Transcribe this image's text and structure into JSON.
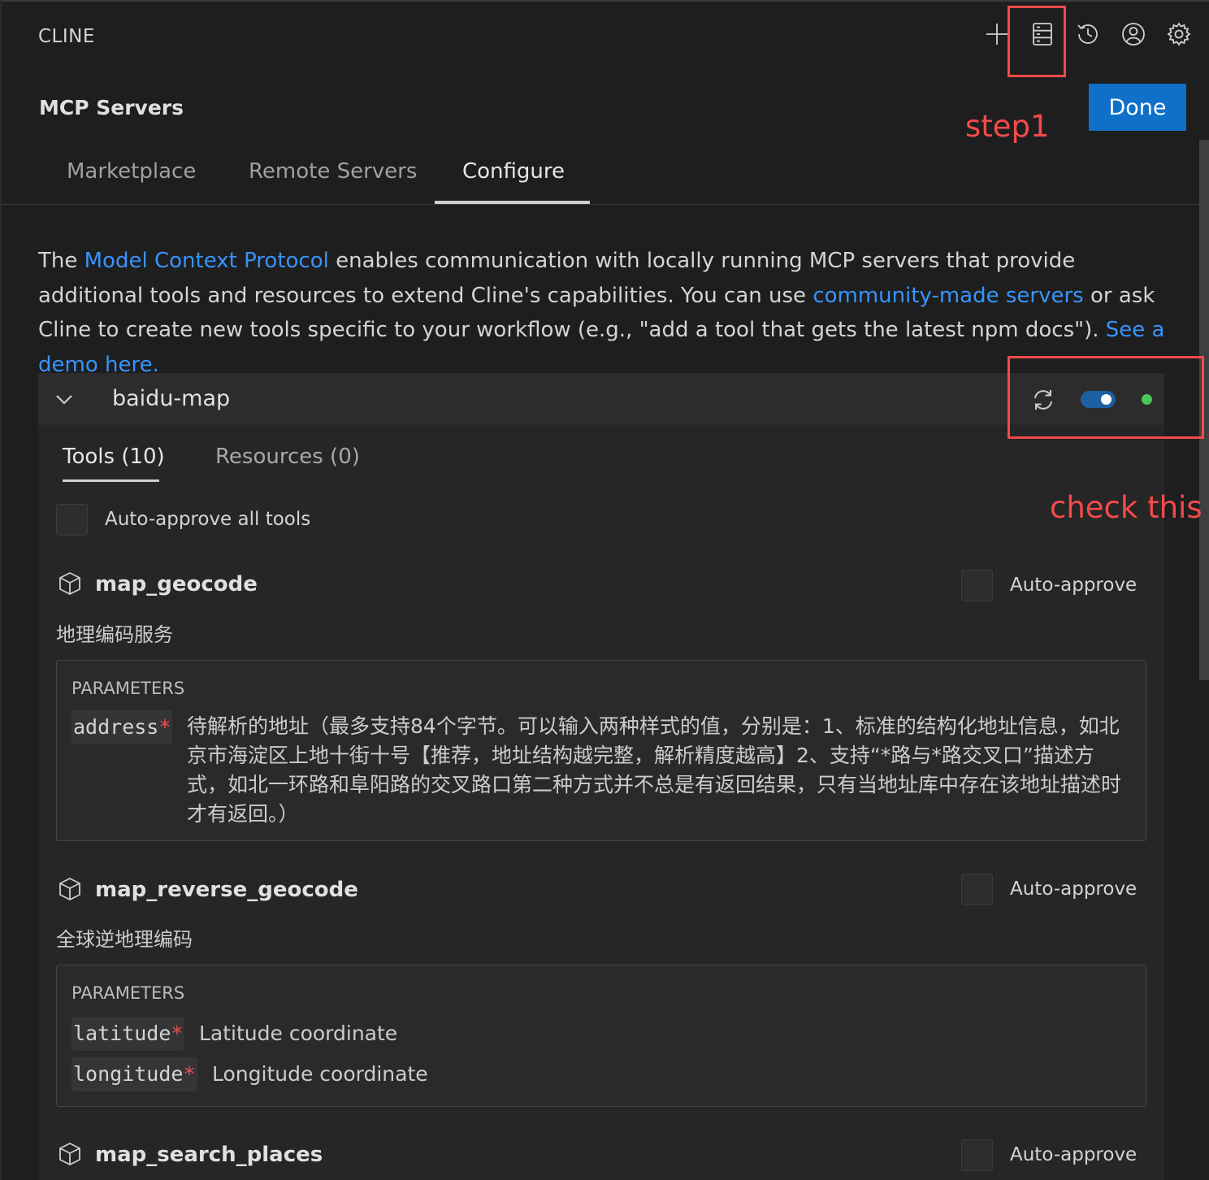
{
  "app": {
    "title": "CLINE"
  },
  "toolbar": {
    "items": [
      {
        "icon": "plus-icon"
      },
      {
        "icon": "server-stack-icon"
      },
      {
        "icon": "history-icon"
      },
      {
        "icon": "account-icon"
      },
      {
        "icon": "gear-icon"
      }
    ]
  },
  "page": {
    "title": "MCP Servers",
    "done_label": "Done"
  },
  "tabs": [
    {
      "label": "Marketplace",
      "active": false
    },
    {
      "label": "Remote Servers",
      "active": false
    },
    {
      "label": "Configure",
      "active": true
    }
  ],
  "intro": {
    "t1": "The ",
    "link1": "Model Context Protocol",
    "t2": " enables communication with locally running MCP servers that provide additional tools and resources to extend Cline's capabilities. You can use ",
    "link2": "community-made servers",
    "t3": " or ask Cline to create new tools specific to your workflow (e.g., \"add a tool that gets the latest npm docs\"). ",
    "link3": "See a demo here."
  },
  "server": {
    "name": "baidu-map",
    "enabled": true,
    "status_color": "#4cc659",
    "subtabs": [
      {
        "label": "Tools (10)",
        "active": true
      },
      {
        "label": "Resources (0)",
        "active": false
      }
    ],
    "auto_approve_all_label": "Auto-approve all tools",
    "auto_approve_label": "Auto-approve",
    "parameters_label": "PARAMETERS",
    "tools": [
      {
        "name": "map_geocode",
        "description": "地理编码服务",
        "params": [
          {
            "name": "address",
            "required": "*",
            "description": "待解析的地址（最多支持84个字节。可以输入两种样式的值，分别是：1、标准的结构化地址信息，如北京市海淀区上地十街十号【推荐，地址结构越完整，解析精度越高】2、支持“*路与*路交叉口”描述方式，如北一环路和阜阳路的交叉路口第二种方式并不总是有返回结果，只有当地址库中存在该地址描述时才有返回。）"
          }
        ]
      },
      {
        "name": "map_reverse_geocode",
        "description": "全球逆地理编码",
        "params": [
          {
            "name": "latitude",
            "required": "*",
            "description": "Latitude coordinate"
          },
          {
            "name": "longitude",
            "required": "*",
            "description": "Longitude coordinate"
          }
        ]
      },
      {
        "name": "map_search_places",
        "description": "",
        "params": []
      }
    ]
  },
  "annotations": {
    "step1": "step1",
    "check": "check this",
    "color": "#f44a4a"
  }
}
